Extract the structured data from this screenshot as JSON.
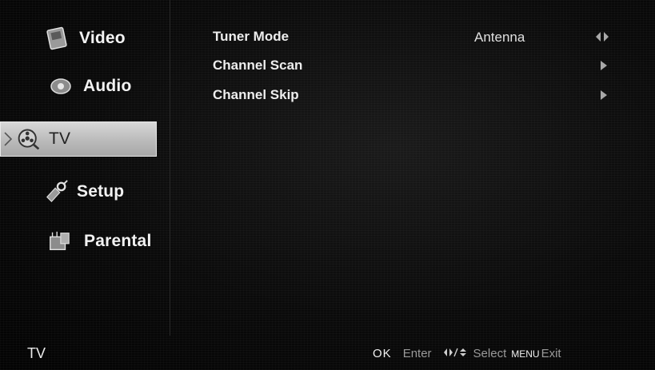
{
  "sidebar": {
    "items": [
      {
        "label": "Video",
        "icon": "video-icon"
      },
      {
        "label": "Audio",
        "icon": "audio-icon"
      },
      {
        "label": "TV",
        "icon": "tv-icon"
      },
      {
        "label": "Setup",
        "icon": "setup-icon"
      },
      {
        "label": "Parental",
        "icon": "parental-icon"
      }
    ],
    "selected": "TV"
  },
  "settings": [
    {
      "label": "Tuner Mode",
      "value": "Antenna",
      "indicator": "left-right-arrow-icon"
    },
    {
      "label": "Channel Scan",
      "value": "",
      "indicator": "right-arrow-icon"
    },
    {
      "label": "Channel Skip",
      "value": "",
      "indicator": "right-arrow-icon"
    }
  ],
  "footer": {
    "title": "TV",
    "ok_key": "OK",
    "ok_action": "Enter",
    "select_action": "Select",
    "menu_key": "MENU",
    "menu_action": "Exit"
  },
  "colors": {
    "background": "#0a0a0a",
    "highlight": "#c4c4c4",
    "text": "#ededed"
  }
}
